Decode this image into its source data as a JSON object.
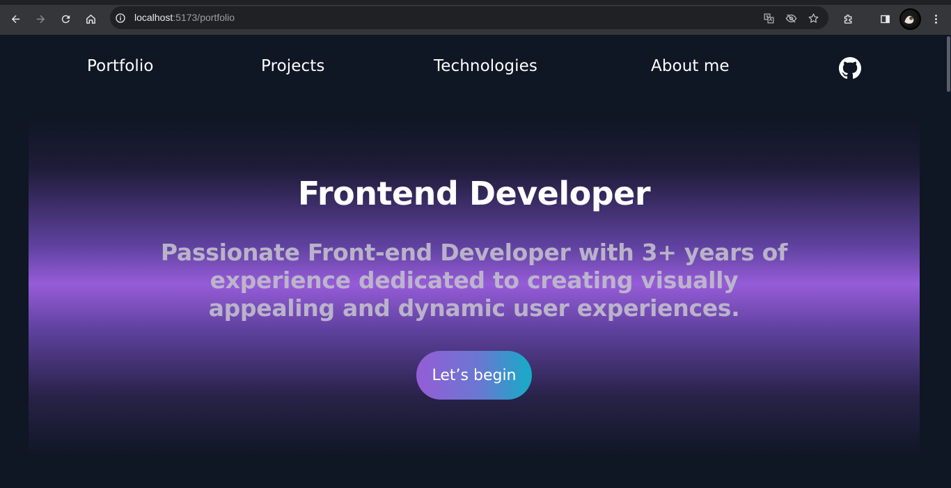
{
  "browser": {
    "url_host": "localhost",
    "url_rest": ":5173/portfolio",
    "icons": [
      "back-icon",
      "forward-icon",
      "reload-icon",
      "home-icon",
      "site-info-icon",
      "translate-icon",
      "tracking-off-icon",
      "bookmark-star-icon",
      "extensions-icon",
      "side-panel-icon",
      "profile-avatar",
      "menu-icon"
    ]
  },
  "nav": {
    "links": [
      "Portfolio",
      "Projects",
      "Technologies",
      "About me"
    ],
    "github_icon": "github-icon"
  },
  "hero": {
    "title": "Frontend Developer",
    "subtitle_lines": [
      "Passionate Front-end Developer with 3+ years of",
      "experience dedicated to creating visually",
      "appealing and dynamic user experiences."
    ],
    "cta_label": "Let’s begin"
  },
  "colors": {
    "page_background": "#0f1624",
    "hero_glow": "#965cd8",
    "button_gradient_start": "#945dd6",
    "button_gradient_end": "#13adc7",
    "subtitle_text": "#c0bccc"
  }
}
